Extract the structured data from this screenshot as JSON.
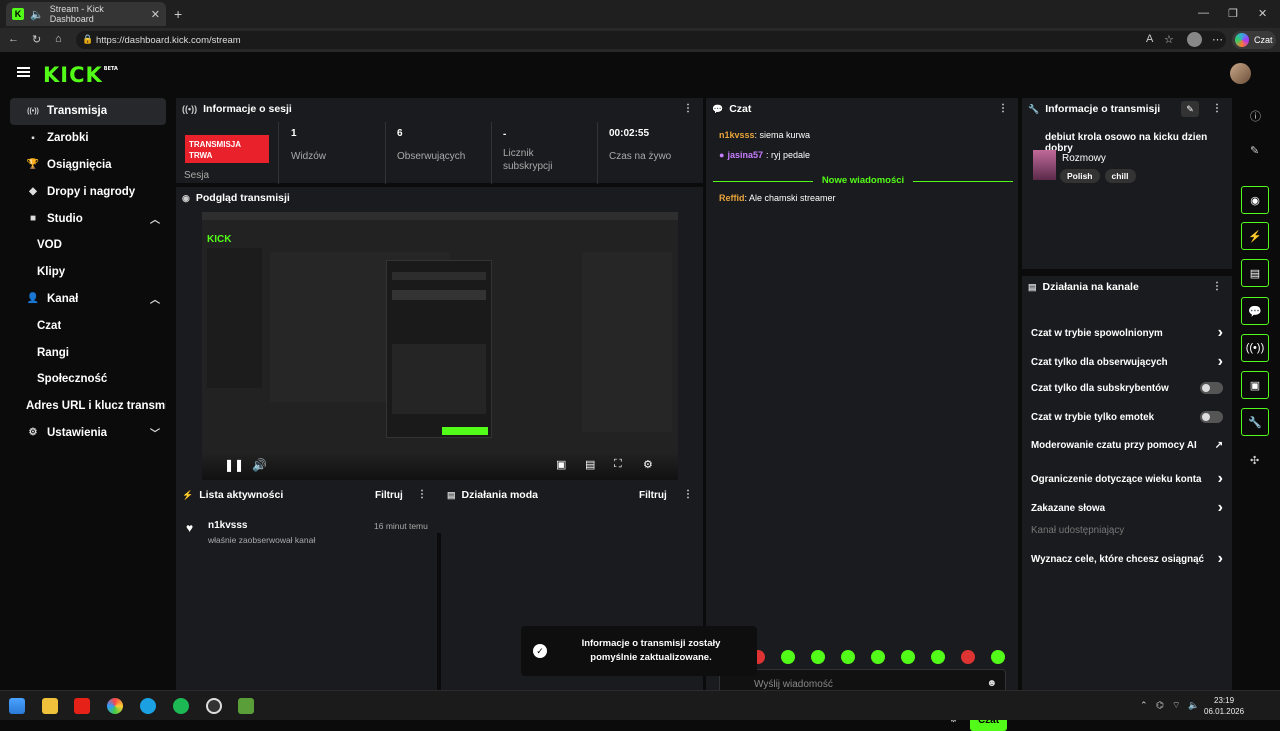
{
  "browser": {
    "tab_title": "Stream - Kick Dashboard",
    "url": "https://dashboard.kick.com/stream",
    "copilot_label": "Czat"
  },
  "app": {
    "logo": "KICK",
    "logo_badge": "BETA"
  },
  "sidebar": {
    "items": [
      {
        "label": "Transmisja",
        "icon": "broadcast-icon",
        "active": true
      },
      {
        "label": "Zarobki",
        "icon": "wallet-icon"
      },
      {
        "label": "Osiągnięcia",
        "icon": "trophy-icon"
      },
      {
        "label": "Dropy i nagrody",
        "icon": "gift-icon"
      },
      {
        "label": "Studio",
        "icon": "studio-icon",
        "chevron": "up"
      },
      {
        "label": "VOD",
        "sub": true
      },
      {
        "label": "Klipy",
        "sub": true
      },
      {
        "label": "Kanał",
        "icon": "user-icon",
        "chevron": "up"
      },
      {
        "label": "Czat",
        "sub": true
      },
      {
        "label": "Rangi",
        "sub": true
      },
      {
        "label": "Społeczność",
        "sub": true
      },
      {
        "label": "Adres URL i klucz transmisji",
        "sub": true
      },
      {
        "label": "Ustawienia",
        "icon": "gear-icon",
        "chevron": "down"
      }
    ]
  },
  "session": {
    "title": "Informacje o sesji",
    "live_badge": "TRANSMISJA TRWA",
    "session_label": "Sesja",
    "stats": [
      {
        "value": "1",
        "label": "Widzów"
      },
      {
        "value": "6",
        "label": "Obserwujących"
      },
      {
        "value": "-",
        "label": "Licznik subskrypcji"
      },
      {
        "value": "00:02:55",
        "label": "Czas na żywo"
      }
    ]
  },
  "preview": {
    "title": "Podgląd transmisji"
  },
  "activity": {
    "title": "Lista aktywności",
    "filter": "Filtruj",
    "items": [
      {
        "user": "n1kvsss",
        "text": "właśnie zaobserwował kanał",
        "time": "16 minut temu"
      }
    ]
  },
  "mod": {
    "title": "Działania moda",
    "filter": "Filtruj"
  },
  "chat": {
    "title": "Czat",
    "messages": [
      {
        "user": "n1kvsss",
        "text": ": siema kurwa",
        "color": "#e7a33b"
      },
      {
        "user": "jasina57",
        "text": ": ryj pedale",
        "color": "#c77dff"
      }
    ],
    "new_divider": "Nowe wiadomości",
    "after": [
      {
        "user": "Reffid",
        "text": ": Ale chamski streamer",
        "color": "#e7a33b"
      }
    ],
    "placeholder": "Wyślij wiadomość",
    "send": "Czat"
  },
  "toast": {
    "text": "Informacje o transmisji zostały pomyślnie zaktualizowane."
  },
  "stream_info": {
    "title": "Informacje o transmisji",
    "stream_title": "debiut krola osowo na kicku dzien dobry",
    "category": "Rozmowy",
    "tags": [
      "Polish",
      "chill"
    ]
  },
  "channel_actions": {
    "title": "Działania na kanale",
    "rows": [
      {
        "label": "Czat w trybie spowolnionym",
        "type": "chevron"
      },
      {
        "label": "Czat tylko dla obserwujących",
        "type": "chevron"
      },
      {
        "label": "Czat tylko dla subskrybentów",
        "type": "toggle"
      },
      {
        "label": "Czat w trybie tylko emotek",
        "type": "toggle"
      },
      {
        "label": "Moderowanie czatu przy pomocy AI",
        "type": "external"
      },
      {
        "label": "Ograniczenie dotyczące wieku konta",
        "type": "chevron"
      },
      {
        "label": "Zakazane słowa",
        "type": "chevron"
      },
      {
        "label": "Kanał udostępniający",
        "type": "muted"
      },
      {
        "label": "Wyznacz cele, które chcesz osiągnąć",
        "type": "chevron"
      }
    ]
  },
  "taskbar": {
    "time": "23:19",
    "date": "06.01.2026"
  }
}
